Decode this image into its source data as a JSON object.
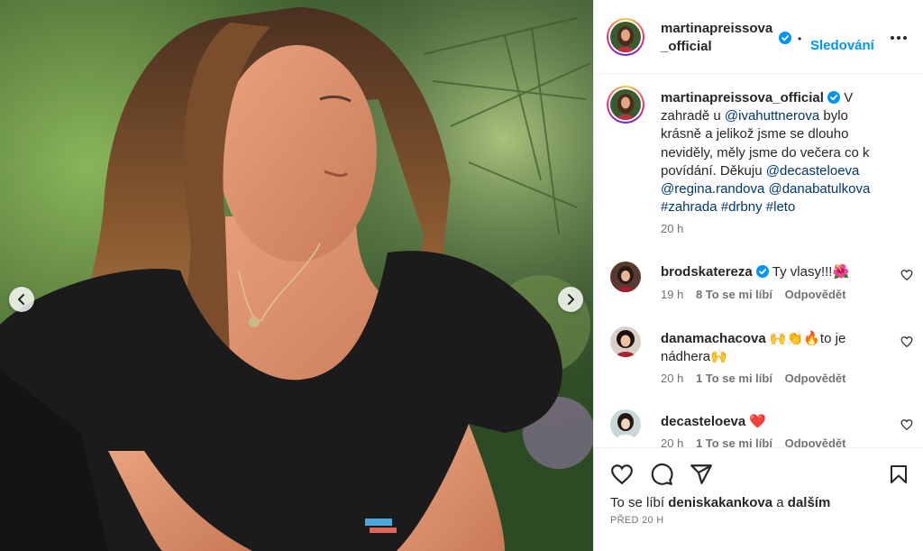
{
  "post": {
    "author": "martinapreissova_official",
    "follow_label": "Sledování",
    "dot": "•",
    "caption": {
      "username": "martinapreissova_official",
      "text_1": " V zahradě u ",
      "mention_1": "@ivahuttnerova",
      "text_2": " bylo krásně a jelikož jsme se dlouho neviděly, měly jsme do večera co k povídání. Děkuju ",
      "mention_2": "@decasteloeva",
      "mention_3": "@regina.randova",
      "mention_4": "@danabatulkova",
      "hashtag_1": "#zahrada",
      "hashtag_2": "#drbny",
      "hashtag_3": "#leto",
      "time": "20 h"
    }
  },
  "comments": [
    {
      "username": "brodskatereza",
      "verified": true,
      "text": "Ty vlasy!!!🌺",
      "time": "19 h",
      "likes": "8 To se mi líbí",
      "reply": "Odpovědět"
    },
    {
      "username": "danamachacova",
      "verified": false,
      "text": "🙌👏🔥to je nádhera🙌",
      "time": "20 h",
      "likes": "1 To se mi líbí",
      "reply": "Odpovědět"
    },
    {
      "username": "decasteloeva",
      "verified": false,
      "text": "❤️",
      "time": "20 h",
      "likes": "1 To se mi líbí",
      "reply": "Odpovědět"
    }
  ],
  "footer": {
    "liked_prefix": "To se líbí ",
    "liked_user": "deniskakankova",
    "liked_mid": " a ",
    "liked_others": "dalším",
    "posted_ago": "PŘED 20 H"
  },
  "icons": {
    "carousel_prev": "chevron-left-icon",
    "carousel_next": "chevron-right-icon",
    "more": "more-horizontal-icon",
    "like": "heart-icon",
    "comment": "comment-icon",
    "share": "paper-plane-icon",
    "save": "bookmark-icon",
    "verified": "verified-badge-icon"
  },
  "colors": {
    "link_blue": "#0095f6",
    "mention": "#00376b",
    "verified": "#0095f6",
    "muted": "#737373"
  }
}
